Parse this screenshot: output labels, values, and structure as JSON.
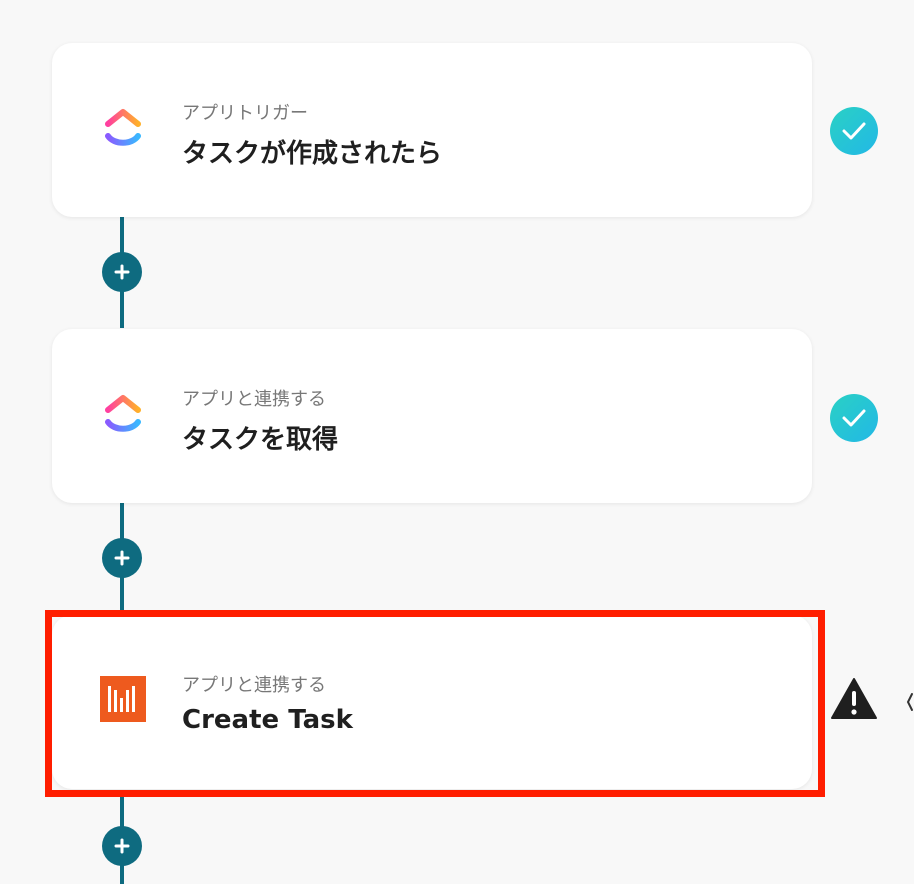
{
  "flow": {
    "steps": [
      {
        "subtitle": "アプリトリガー",
        "title": "タスクが作成されたら",
        "app_icon": "clickup-icon",
        "status_icon": "check-circle-icon"
      },
      {
        "subtitle": "アプリと連携する",
        "title": "タスクを取得",
        "app_icon": "clickup-icon",
        "status_icon": "check-circle-icon"
      },
      {
        "subtitle": "アプリと連携する",
        "title": "Create Task",
        "app_icon": "hive-icon",
        "status_icon": "warning-triangle-icon"
      }
    ],
    "add_step_icon": "plus-icon"
  },
  "colors": {
    "background": "#f8f8f8",
    "connector": "#0e6b80",
    "check_gradient_start": "#2ad1c4",
    "check_gradient_end": "#22b8e6",
    "warning": "#1f1f1f",
    "highlight": "#ff1e00",
    "hive_orange": "#ee5a1e"
  }
}
